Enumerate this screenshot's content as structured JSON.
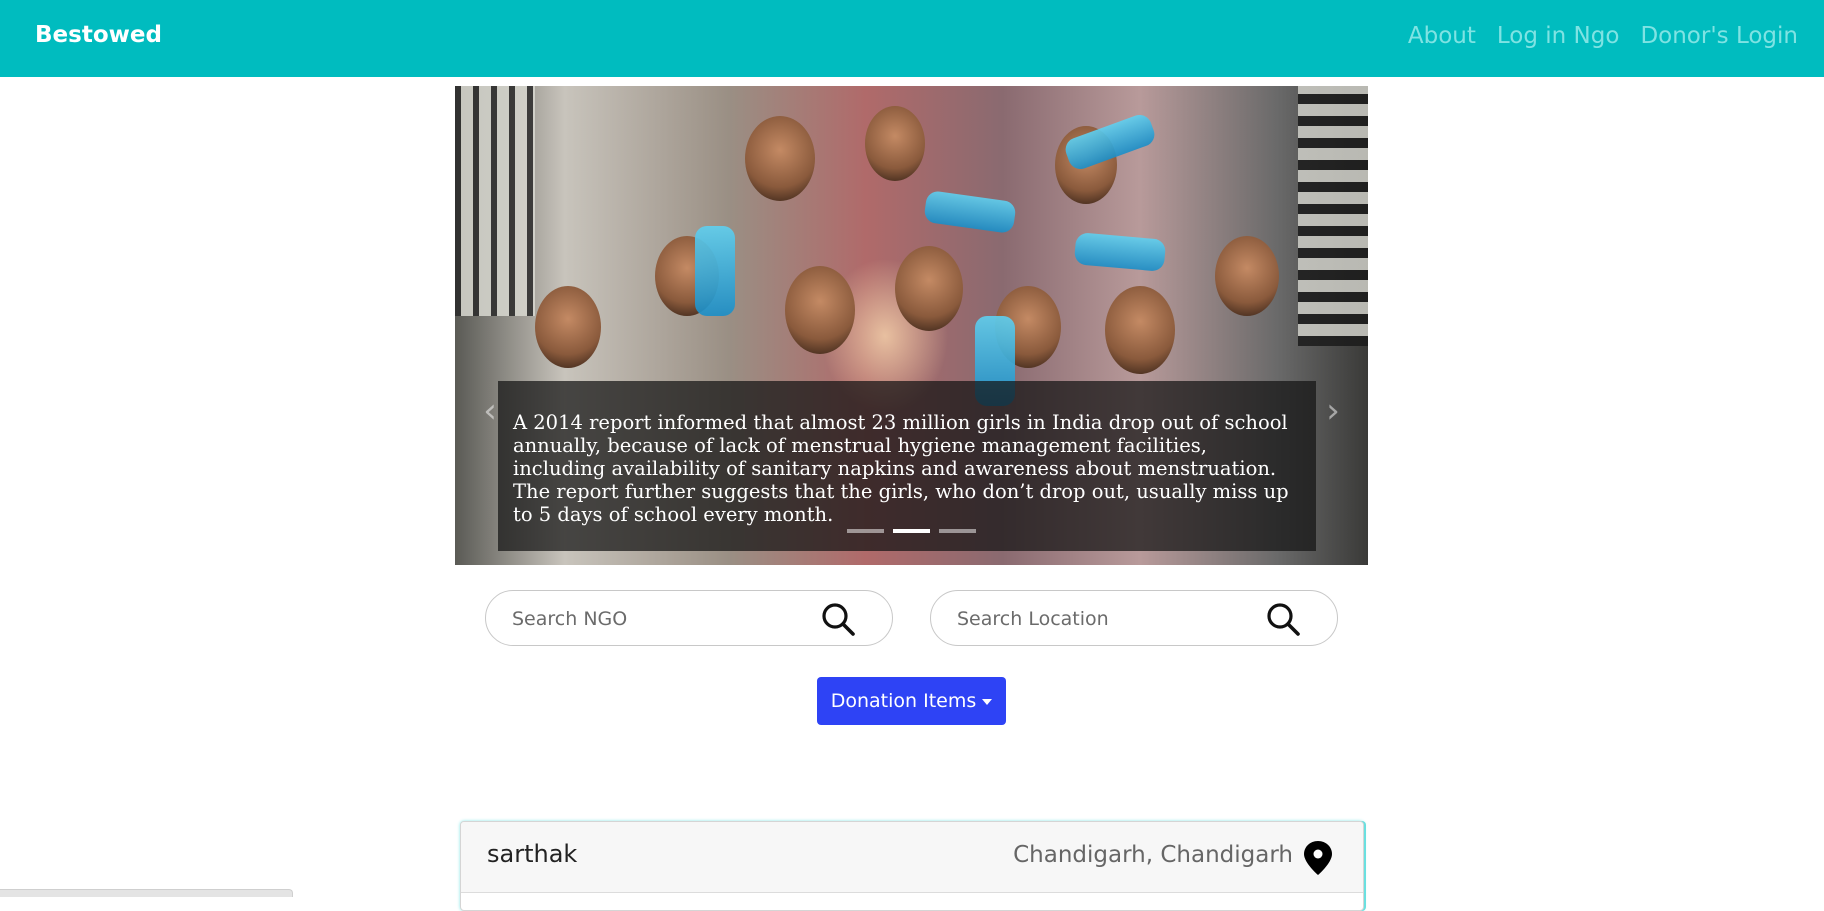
{
  "navbar": {
    "brand": "Bestowed",
    "links": [
      "About",
      "Log in Ngo",
      "Donor's Login"
    ]
  },
  "carousel": {
    "caption": "A 2014 report informed that almost 23 million girls in India drop out of school annually, because of lack of menstrual hygiene management facilities, including availability of sanitary napkins and awareness about menstruation. The report further suggests that the girls, who don’t drop out, usually miss up to 5 days of school every month.",
    "slide_count": 3,
    "active_slide": 2,
    "prev_symbol": "‹",
    "next_symbol": "›"
  },
  "search": {
    "ngo_placeholder": "Search NGO",
    "location_placeholder": "Search Location"
  },
  "dropdown": {
    "label": "Donation Items"
  },
  "ngo_card": {
    "name": "sarthak",
    "location": "Chandigarh, Chandigarh"
  },
  "colors": {
    "navbar": "#00bcbf",
    "nav_link": "#7fe3e3",
    "button": "#2e43f5"
  }
}
